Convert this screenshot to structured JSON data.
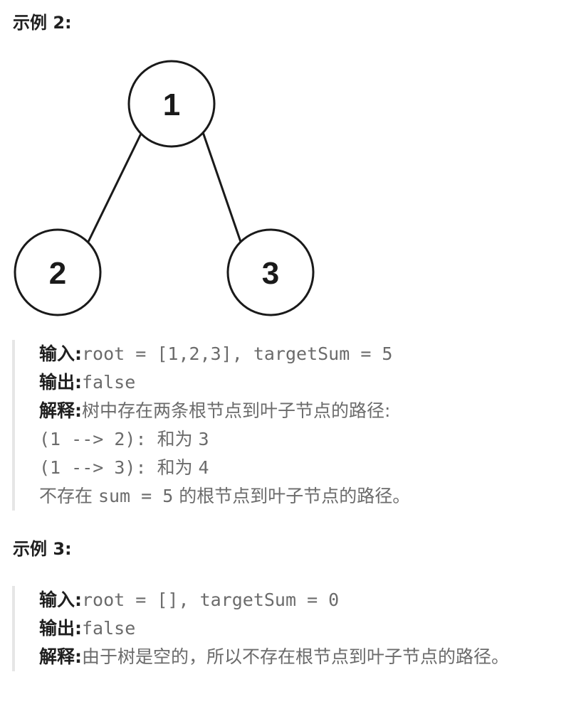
{
  "example2": {
    "heading": "示例 2:",
    "tree": {
      "nodes": [
        {
          "id": "root",
          "value": "1"
        },
        {
          "id": "left",
          "value": "2"
        },
        {
          "id": "right",
          "value": "3"
        }
      ]
    },
    "input_label": "输入:",
    "input_value": "root = [1,2,3], targetSum = 5",
    "output_label": "输出:",
    "output_value": "false",
    "explain_label": "解释:",
    "explain_text": "树中存在两条根节点到叶子节点的路径:",
    "path1_mono": "(1 --> 2): ",
    "path1_text": "和为 ",
    "path1_sum": "3",
    "path2_mono": "(1 --> 3): ",
    "path2_text": "和为 ",
    "path2_sum": "4",
    "note_prefix": "不存在 ",
    "note_mono": "sum = 5",
    "note_suffix": " 的根节点到叶子节点的路径。"
  },
  "example3": {
    "heading": "示例 3:",
    "input_label": "输入:",
    "input_value": "root = [], targetSum = 0",
    "output_label": "输出:",
    "output_value": "false",
    "explain_label": "解释:",
    "explain_text": "由于树是空的，所以不存在根节点到叶子节点的路径。"
  }
}
